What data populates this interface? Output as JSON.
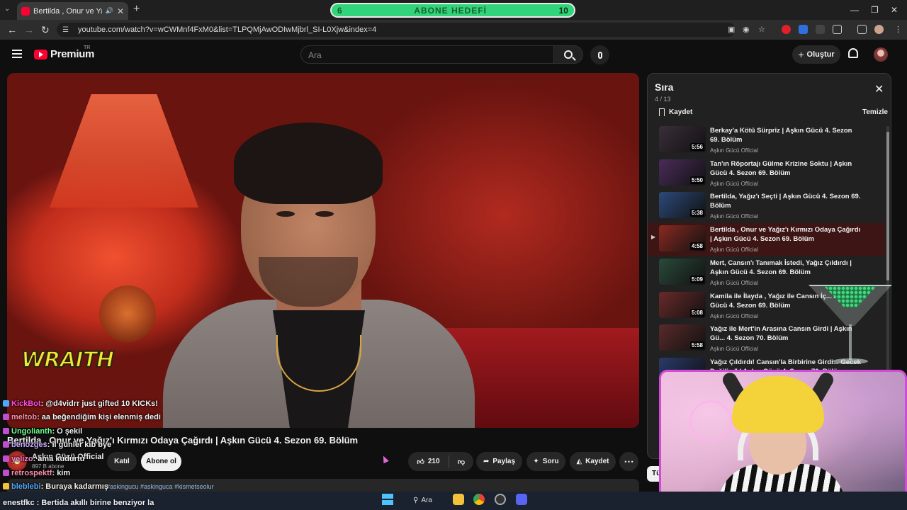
{
  "browser": {
    "tab_title": "Bertilda , Onur ve Yağız'ı Kı",
    "url": "youtube.com/watch?v=wCWMnf4FxM0&list=TLPQMjAwODIwMjbrl_SI-L0Xjw&index=4",
    "goal_title": "ABONE HEDEFİ",
    "goal_left": "6",
    "goal_right": "10"
  },
  "header": {
    "brand": "Premium",
    "country": "TR",
    "search_placeholder": "Ara",
    "create_label": "Oluştur"
  },
  "video": {
    "watermark": "WRAITH",
    "title": "Bertilda , Onur ve Yağız'ı Kırmızı Odaya Çağırdı | Aşkın Gücü 4. Sezon 69. Bölüm",
    "channel": "Aşkın Gücü Official",
    "subscribers": "897 B abone",
    "join_label": "Katıl",
    "subscribe_label": "Abone ol",
    "likes": "210",
    "share_label": "Paylaş",
    "ask_label": "Soru",
    "save_label": "Kaydet",
    "description_preview": "#askingucu #askinguca #kismetseolur",
    "tu_label": "Tü"
  },
  "queue": {
    "title": "Sıra",
    "position": "4 / 13",
    "save_label": "Kaydet",
    "clear_label": "Temizle",
    "items": [
      {
        "title": "Berkay'a Kötü Sürpriz | Aşkın Gücü 4. Sezon 69. Bölüm",
        "channel": "Aşkın Gücü Official",
        "duration": "5:56",
        "color": "#3a2e3a"
      },
      {
        "title": "Tan'ın Röportajı Gülme Krizine Soktu | Aşkın Gücü 4. Sezon 69. Bölüm",
        "channel": "Aşkın Gücü Official",
        "duration": "5:50",
        "color": "#4a2c5a"
      },
      {
        "title": "Bertilda, Yağız'ı Seçti | Aşkın Gücü 4. Sezon 69. Bölüm",
        "channel": "Aşkın Gücü Official",
        "duration": "5:38",
        "color": "#2c4a7a"
      },
      {
        "title": "Bertilda , Onur ve Yağız'ı Kırmızı Odaya Çağırdı | Aşkın Gücü 4. Sezon 69. Bölüm",
        "channel": "Aşkın Gücü Official",
        "duration": "4:58",
        "color": "#8a2a22"
      },
      {
        "title": "Mert, Cansın'ı Tanımak İstedi, Yağız Çıldırdı | Aşkın Gücü 4. Sezon 69. Bölüm",
        "channel": "Aşkın Gücü Official",
        "duration": "5:09",
        "color": "#2a4a3a"
      },
      {
        "title": "Kamila ile İlayda , Yağız ile Cansın İç... Aşkın Gücü 4. Sezon 69. Bölüm",
        "channel": "Aşkın Gücü Official",
        "duration": "5:08",
        "color": "#6a2a2a"
      },
      {
        "title": "Yağız ile Mert'in Arasına Cansın Girdi | Aşkın Gü... 4. Sezon 70. Bölüm",
        "channel": "Aşkın Gücü Official",
        "duration": "5:58",
        "color": "#5a2a2a"
      },
      {
        "title": "Yağız Çıldırdı! Cansın'la Birbirine Girdi... Gecek Değilim\" | Aşkın Gücü 4. Sezon 70. Bölüm",
        "channel": "",
        "duration": "",
        "color": "#2a3a6a"
      }
    ],
    "active_index": 3
  },
  "chat": [
    {
      "user": "KickBot",
      "msg": ": @d4vidrr just gifted 10 KICKs!",
      "color": "#ff4fd8",
      "badge": "#4fa8ff"
    },
    {
      "user": "meltob",
      "msg": ": aa beğendiğim kişi elenmiş dedi",
      "color": "#ff8fa8",
      "badge": "#c04fd0"
    },
    {
      "user": "Ungolianth",
      "msg": ": O şekil",
      "color": "#6fff8f",
      "badge": "#c04fd0"
    },
    {
      "user": "benozges",
      "msg": ": il günler kib bye",
      "color": "#c8a8ff",
      "badge": "#c04fd0"
    },
    {
      "user": "yelizo",
      "msg": ": ama kudurtu",
      "color": "#ff7fd0",
      "badge": "#c04fd0"
    },
    {
      "user": "retrospektf",
      "msg": ": kim",
      "color": "#ff8fa8",
      "badge": "#c04fd0"
    },
    {
      "user": "bleblebi",
      "msg": ": Buraya kadarmış",
      "color": "#4fa8ff",
      "badge": "#f3c13a"
    }
  ],
  "last_chat": "enestfkc : Bertida akıllı birine benziyor la",
  "taskbar": {
    "search_label": "Ara"
  }
}
